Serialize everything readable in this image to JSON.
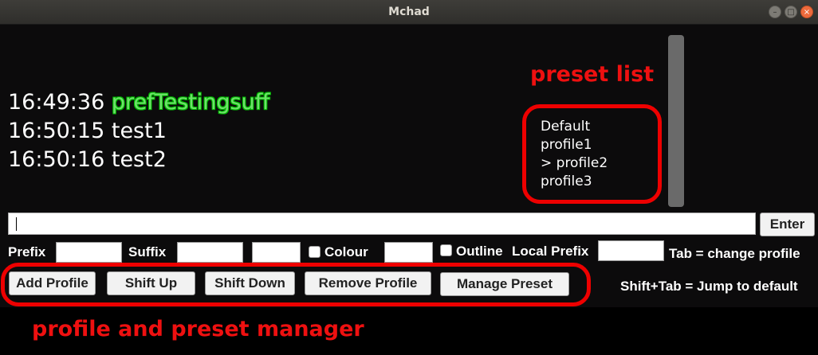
{
  "window": {
    "title": "Mchad"
  },
  "chat": {
    "lines": [
      {
        "time": "16:49:36",
        "message": "prefTestingsuff"
      },
      {
        "time": "16:50:15",
        "message": "test1"
      },
      {
        "time": "16:50:16",
        "message": "test2"
      }
    ]
  },
  "presets": {
    "items": [
      "Default",
      "profile1",
      "> profile2",
      "profile3"
    ]
  },
  "annotations": {
    "preset_list": "preset list",
    "manager": "profile and preset manager"
  },
  "input": {
    "value": "",
    "enter_label": "Enter"
  },
  "options": {
    "prefix_label": "Prefix",
    "suffix_label": "Suffix",
    "colour_label": "Colour",
    "outline_label": "Outline",
    "local_prefix_label": "Local Prefix",
    "hint_tab": "Tab = change profile",
    "hint_shift_tab": "Shift+Tab = Jump to default"
  },
  "manager": {
    "add_profile": "Add Profile",
    "shift_up": "Shift Up",
    "shift_down": "Shift Down",
    "remove_profile": "Remove Profile",
    "manage_preset": "Manage Preset"
  },
  "colors": {
    "annotation": "#ee0000",
    "outlined_text": "#6fe06b"
  }
}
